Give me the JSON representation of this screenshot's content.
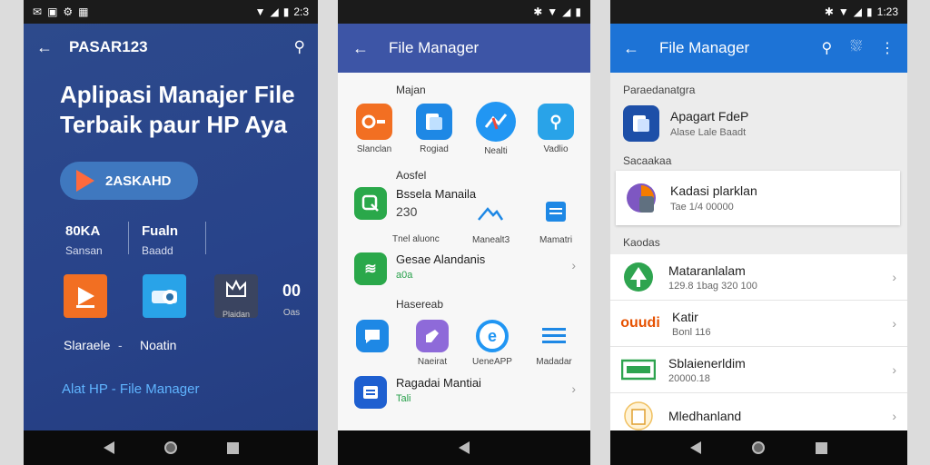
{
  "phone1": {
    "status_time": "2:3",
    "appbar_title": "PASAR123",
    "hero_line1": "Aplipasi Manajer File",
    "hero_line2": "Terbaik paur HP Aya",
    "pill_label": "2ASKAHD",
    "stats": [
      {
        "value": "80KA",
        "label": "Sansan"
      },
      {
        "value": "Fualn",
        "label": "Baadd"
      }
    ],
    "tiles": [
      {
        "label": ""
      },
      {
        "label": ""
      },
      {
        "label": "Plaidan"
      },
      {
        "label": "Oas",
        "glyph": "00"
      }
    ],
    "captions": [
      "Slaraele",
      "Noatin"
    ],
    "footer_link": "Alat HP - File Manager"
  },
  "phone2": {
    "appbar_title": "File Manager",
    "section1": "Majan",
    "grid1": [
      {
        "label": "Slanclan",
        "color": "#f26f22"
      },
      {
        "label": "Rogiad",
        "color": "#1e88e5"
      },
      {
        "label": "Nealti",
        "color": "#2196f3"
      },
      {
        "label": "Vadlio",
        "color": "#29a3e8"
      }
    ],
    "section2": "Aosfel",
    "row1": {
      "title": "Bssela Manaila",
      "sub": "230"
    },
    "mini_icons": [
      {
        "label": "Tnel aluonc"
      },
      {
        "label": "Manealt3"
      },
      {
        "label": "Mamatri"
      }
    ],
    "row2": {
      "title": "Gesae Alandanis",
      "sub": "a0a"
    },
    "section3": "Hasereab",
    "grid2": [
      {
        "label": "",
        "color": "#1e88e5"
      },
      {
        "label": "Naeirat",
        "color": "#8e6ad9"
      },
      {
        "label": "UeneAPP",
        "color": "#2196f3"
      },
      {
        "label": "Madadar",
        "color": "#1e88e5"
      }
    ],
    "row3": {
      "title": "Ragadai Mantiai",
      "sub": "Tali"
    }
  },
  "phone3": {
    "status_time": "1:23",
    "appbar_title": "File Manager",
    "section1": "Paraedanatgra",
    "card1": {
      "title": "Apagart FdeP",
      "sub": "Alase Lale Baadt"
    },
    "section2": "Sacaakaa",
    "card2": {
      "title": "Kadasi plarklan",
      "sub": "Tae 1/4 00000"
    },
    "section3": "Kaodas",
    "list": [
      {
        "title": "Mataranlalam",
        "sub": "129.8 1bag 320 100",
        "icon": "tree"
      },
      {
        "title": "Katir",
        "sub": "Bonl 116",
        "icon": "ouudi"
      },
      {
        "title": "Sblaienerldim",
        "sub": "20000.18",
        "icon": "card"
      },
      {
        "title": "Mledhanland",
        "sub": "",
        "icon": "doc"
      }
    ]
  },
  "colors": {
    "p1_bg": "#2b4689",
    "p2_appbar": "#3d55a6",
    "p3_appbar": "#1d73d6",
    "link": "#5fb4ff",
    "accent_green": "#27a04a"
  }
}
